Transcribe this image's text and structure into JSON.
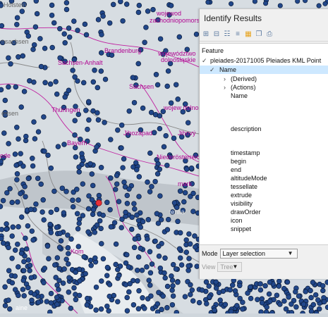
{
  "map": {
    "labels": [
      {
        "text": "Holstein"
      },
      {
        "text": "wojewod"
      },
      {
        "text": "zachodniopomorskie"
      },
      {
        "text": "nsachsen"
      },
      {
        "text": "Brandenburg"
      },
      {
        "text": "województwo"
      },
      {
        "text": "dolnośląskie"
      },
      {
        "text": "Sachsen-Anhalt"
      },
      {
        "text": "Sachsen"
      },
      {
        "text": "Thüringen"
      },
      {
        "text": "essen"
      },
      {
        "text": "Jihozápad"
      },
      {
        "text": "Jihový"
      },
      {
        "text": "Bayern"
      },
      {
        "text": "Niederösterreich"
      },
      {
        "text": "ode"
      },
      {
        "text": "mark"
      },
      {
        "text": "tenlia"
      },
      {
        "text": "Kom"
      },
      {
        "text": "aine"
      },
      {
        "text": "wojew dolnoś"
      }
    ],
    "colors": {
      "point_fill": "#21478a",
      "point_stroke": "#0b1c3a",
      "selected_point": "#e8313a",
      "border": "#c020a0",
      "land": "#d7dde2",
      "terrain": "#c7ccd1"
    }
  },
  "identify": {
    "title": "Identify Results",
    "toolbar_icons": [
      "expand-tree-icon",
      "collapse-tree-icon",
      "expand-new-icon",
      "clear-results-icon",
      "highlight-feature-icon",
      "copy-feature-icon",
      "print-icon"
    ],
    "feature_header": "Feature",
    "feature_name": "pleiades-20171005 Pleiades KML Point",
    "name_node": "Name",
    "derived": "(Derived)",
    "actions": "(Actions)",
    "attributes": [
      "Name",
      "description",
      "timestamp",
      "begin",
      "end",
      "altitudeMode",
      "tessellate",
      "extrude",
      "visibility",
      "drawOrder",
      "icon",
      "snippet"
    ],
    "mode_label": "Mode",
    "mode_value": "Layer selection",
    "view_label": "View",
    "view_value": "Tree"
  }
}
